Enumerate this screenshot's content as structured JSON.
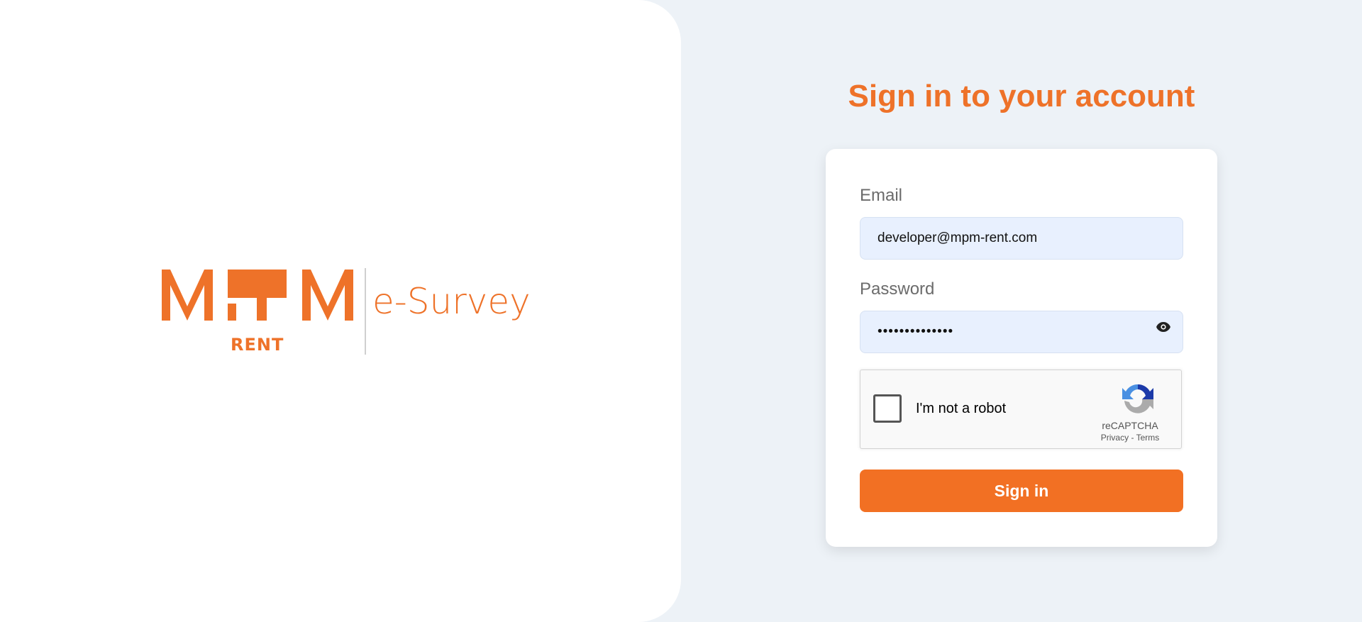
{
  "colors": {
    "brand_orange": "#ee7229",
    "button_orange": "#f27023",
    "page_background": "#edf2f7",
    "input_background": "#e8f0fe"
  },
  "logo": {
    "mark": "MPM",
    "rent": "RENT",
    "product": "e-Survey"
  },
  "form": {
    "title": "Sign in to your account",
    "email_label": "Email",
    "email_value": "developer@mpm-rent.com",
    "password_label": "Password",
    "password_value": "••••••••••••••",
    "password_toggle_icon": "eye-icon",
    "submit_label": "Sign in"
  },
  "captcha": {
    "label": "I'm not a robot",
    "brand": "reCAPTCHA",
    "privacy": "Privacy",
    "separator": "-",
    "terms": "Terms",
    "icon": "recaptcha-icon"
  }
}
